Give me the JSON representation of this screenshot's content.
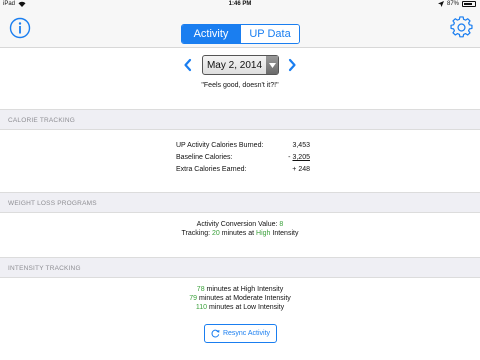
{
  "status_bar": {
    "carrier": "iPad",
    "time": "1:46 PM",
    "battery_text": "87%",
    "battery_level": 0.87
  },
  "nav": {
    "tabs": [
      {
        "label": "Activity",
        "active": true
      },
      {
        "label": "UP Data",
        "active": false
      }
    ],
    "info_icon": "info-circle-icon",
    "settings_icon": "gear-icon",
    "accent_color": "#1a7ef0"
  },
  "date": {
    "value": "May 2, 2014",
    "prev_icon": "chevron-left-icon",
    "next_icon": "chevron-right-icon"
  },
  "quote": "\"Feels good, doesn't it?!\"",
  "calorie_tracking": {
    "header": "CALORIE TRACKING",
    "rows": [
      {
        "label": "UP Activity Calories Burned:",
        "sign": "",
        "value": "3,453"
      },
      {
        "label": "Baseline Calories:",
        "sign": "-",
        "value": "3,205"
      },
      {
        "label": "Extra Calories Earned:",
        "sign": "+",
        "value": "248"
      }
    ]
  },
  "weight_loss": {
    "header": "WEIGHT LOSS PROGRAMS",
    "conversion_label": "Activity Conversion Value:",
    "conversion_value": "8",
    "tracking_label": "Tracking:",
    "tracking_minutes": "20",
    "tracking_mid": "minutes at",
    "tracking_level": "High",
    "tracking_suffix": "Intensity"
  },
  "intensity": {
    "header": "INTENSITY TRACKING",
    "rows": [
      {
        "minutes": "78",
        "text": "minutes at High Intensity"
      },
      {
        "minutes": "79",
        "text": "minutes at Moderate Intensity"
      },
      {
        "minutes": "110",
        "text": "minutes at Low Intensity"
      }
    ]
  },
  "resync_label": "Resync Activity",
  "colors": {
    "green": "#3aa03a",
    "header_bg": "#efeff4",
    "header_text": "#8e8e93"
  }
}
